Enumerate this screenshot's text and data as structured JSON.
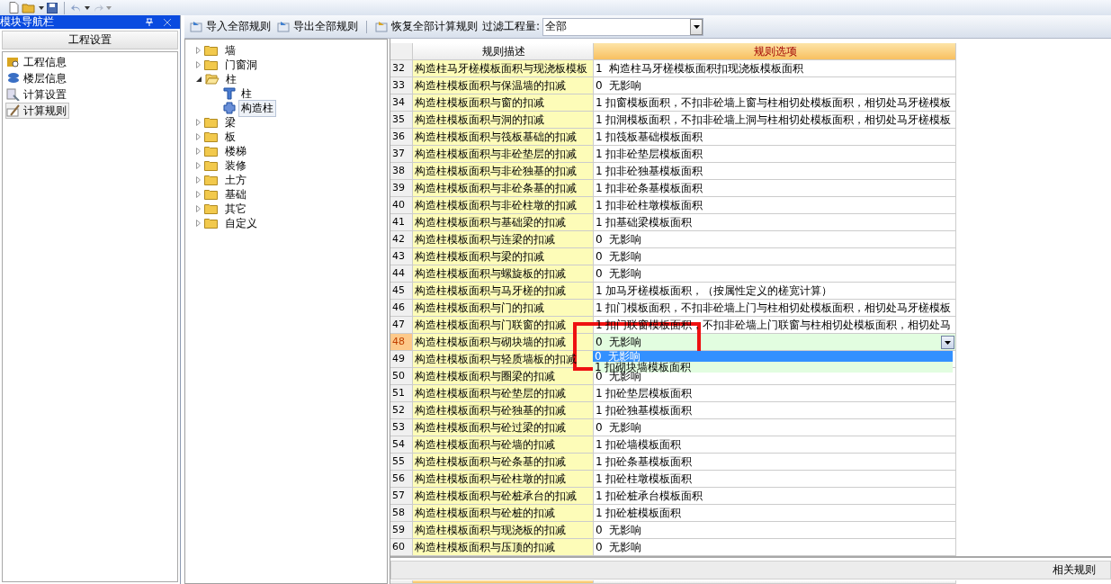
{
  "nav_panel": {
    "title": "模块导航栏",
    "section": "工程设置",
    "items": [
      {
        "label": "工程信息",
        "kind": "info",
        "selected": false
      },
      {
        "label": "楼层信息",
        "kind": "floor",
        "selected": false
      },
      {
        "label": "计算设置",
        "kind": "settings",
        "selected": false
      },
      {
        "label": "计算规则",
        "kind": "rules",
        "selected": true
      }
    ]
  },
  "toolbar": {
    "buttons": [
      {
        "label": "导入全部规则",
        "kind": "import"
      },
      {
        "label": "导出全部规则",
        "kind": "export"
      },
      {
        "label": "恢复全部计算规则",
        "kind": "restore"
      }
    ],
    "filter": {
      "label": "过滤工程量:",
      "value": "全部"
    }
  },
  "tree": [
    {
      "label": "墙",
      "expanded": false
    },
    {
      "label": "门窗洞",
      "expanded": false
    },
    {
      "label": "柱",
      "expanded": true,
      "children": [
        {
          "label": "柱",
          "kind": "column",
          "selected": false
        },
        {
          "label": "构造柱",
          "kind": "construct",
          "selected": true
        }
      ]
    },
    {
      "label": "梁",
      "expanded": false
    },
    {
      "label": "板",
      "expanded": false
    },
    {
      "label": "楼梯",
      "expanded": false
    },
    {
      "label": "装修",
      "expanded": false
    },
    {
      "label": "土方",
      "expanded": false
    },
    {
      "label": "基础",
      "expanded": false
    },
    {
      "label": "其它",
      "expanded": false
    },
    {
      "label": "自定义",
      "expanded": false
    }
  ],
  "table": {
    "columns": [
      {
        "label": "规则描述",
        "selected": false
      },
      {
        "label": "规则选项",
        "selected": true
      }
    ],
    "rows": [
      {
        "number": "32",
        "description": "构造柱马牙槎模板面积与现浇板模板",
        "option": "1  构造柱马牙槎模板面积扣现浇板模板面积",
        "selected": false
      },
      {
        "number": "33",
        "description": "构造柱模板面积与保温墙的扣减",
        "option": "0  无影响",
        "selected": false
      },
      {
        "number": "34",
        "description": "构造柱模板面积与窗的扣减",
        "option": "1 扣窗模板面积，不扣非砼墙上窗与柱相切处模板面积，相切处马牙槎模板",
        "selected": false
      },
      {
        "number": "35",
        "description": "构造柱模板面积与洞的扣减",
        "option": "1 扣洞模板面积，不扣非砼墙上洞与柱相切处模板面积，相切处马牙槎模板",
        "selected": false
      },
      {
        "number": "36",
        "description": "构造柱模板面积与筏板基础的扣减",
        "option": "1 扣筏板基础模板面积",
        "selected": false
      },
      {
        "number": "37",
        "description": "构造柱模板面积与非砼垫层的扣减",
        "option": "1 扣非砼垫层模板面积",
        "selected": false
      },
      {
        "number": "38",
        "description": "构造柱模板面积与非砼独基的扣减",
        "option": "1 扣非砼独基模板面积",
        "selected": false
      },
      {
        "number": "39",
        "description": "构造柱模板面积与非砼条基的扣减",
        "option": "1 扣非砼条基模板面积",
        "selected": false
      },
      {
        "number": "40",
        "description": "构造柱模板面积与非砼柱墩的扣减",
        "option": "1 扣非砼柱墩模板面积",
        "selected": false
      },
      {
        "number": "41",
        "description": "构造柱模板面积与基础梁的扣减",
        "option": "1 扣基础梁模板面积",
        "selected": false
      },
      {
        "number": "42",
        "description": "构造柱模板面积与连梁的扣减",
        "option": "0  无影响",
        "selected": false
      },
      {
        "number": "43",
        "description": "构造柱模板面积与梁的扣减",
        "option": "0  无影响",
        "selected": false
      },
      {
        "number": "44",
        "description": "构造柱模板面积与螺旋板的扣减",
        "option": "0  无影响",
        "selected": false
      },
      {
        "number": "45",
        "description": "构造柱模板面积与马牙槎的扣减",
        "option": "1 加马牙槎模板面积，（按属性定义的槎宽计算）",
        "selected": false
      },
      {
        "number": "46",
        "description": "构造柱模板面积与门的扣减",
        "option": "1 扣门模板面积，不扣非砼墙上门与柱相切处模板面积，相切处马牙槎模板",
        "selected": false
      },
      {
        "number": "47",
        "description": "构造柱模板面积与门联窗的扣减",
        "option": "1 扣门联窗模板面积，不扣非砼墙上门联窗与柱相切处模板面积，相切处马",
        "selected": false
      },
      {
        "number": "48",
        "description": "构造柱模板面积与砌块墙的扣减",
        "option": "0  无影响",
        "selected": true
      },
      {
        "number": "49",
        "description": "构造柱模板面积与轻质墙板的扣减",
        "selected": false
      },
      {
        "number": "50",
        "description": "构造柱模板面积与圈梁的扣减",
        "option": "0  无影响",
        "selected": false
      },
      {
        "number": "51",
        "description": "构造柱模板面积与砼垫层的扣减",
        "option": "1 扣砼垫层模板面积",
        "selected": false
      },
      {
        "number": "52",
        "description": "构造柱模板面积与砼独基的扣减",
        "option": "1 扣砼独基模板面积",
        "selected": false
      },
      {
        "number": "53",
        "description": "构造柱模板面积与砼过梁的扣减",
        "option": "0  无影响",
        "selected": false
      },
      {
        "number": "54",
        "description": "构造柱模板面积与砼墙的扣减",
        "option": "1 扣砼墙模板面积",
        "selected": false
      },
      {
        "number": "55",
        "description": "构造柱模板面积与砼条基的扣减",
        "option": "1 扣砼条基模板面积",
        "selected": false
      },
      {
        "number": "56",
        "description": "构造柱模板面积与砼柱墩的扣减",
        "option": "1 扣砼柱墩模板面积",
        "selected": false
      },
      {
        "number": "57",
        "description": "构造柱模板面积与砼桩承台的扣减",
        "option": "1 扣砼桩承台模板面积",
        "selected": false
      },
      {
        "number": "58",
        "description": "构造柱模板面积与砼桩的扣减",
        "option": "1 扣砼桩模板面积",
        "selected": false
      },
      {
        "number": "59",
        "description": "构造柱模板面积与现浇板的扣减",
        "option": "0  无影响",
        "selected": false
      },
      {
        "number": "60",
        "description": "构造柱模板面积与压顶的扣减",
        "option": "0  无影响",
        "selected": false
      }
    ],
    "dropdown": {
      "options": [
        {
          "label": "0  无影响",
          "selected": true
        },
        {
          "label": "1 扣砌块墙模板面积",
          "selected": false
        }
      ]
    }
  },
  "related_panel": {
    "title": "相关规则"
  }
}
